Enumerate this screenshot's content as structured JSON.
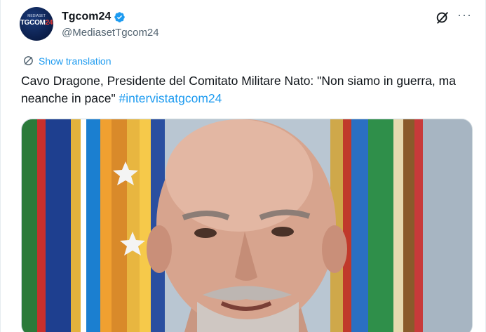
{
  "account": {
    "avatar_brand_top": "MEDIASET",
    "avatar_brand_main": "TGCOM",
    "avatar_brand_num": "24",
    "display_name": "Tgcom24",
    "handle": "@MediasetTgcom24"
  },
  "actions": {
    "grok_icon": "grok-icon",
    "more_label": "···"
  },
  "translation": {
    "label": "Show translation"
  },
  "tweet": {
    "text": "Cavo Dragone, Presidente del Comitato Militare Nato: \"Non siamo in guerra, ma neanche in pace\" ",
    "hashtag": "#intervistatgcom24"
  },
  "media": {
    "subject": "photo-portrait"
  },
  "colors": {
    "accent": "#1d9bf0",
    "text": "#0f1419",
    "secondary": "#536471"
  }
}
